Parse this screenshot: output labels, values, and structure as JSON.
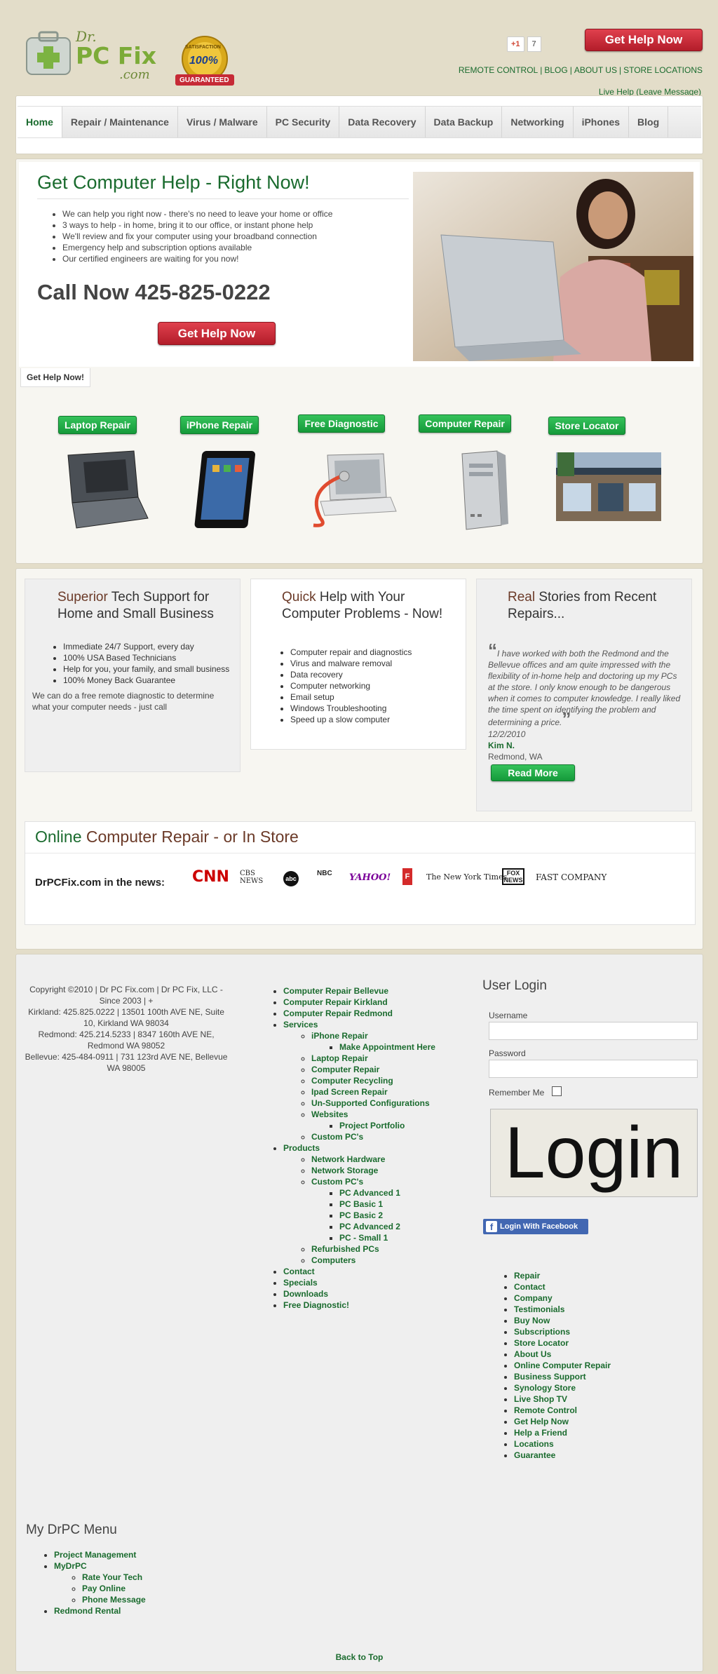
{
  "header": {
    "logo": {
      "dr": "Dr.",
      "name": "PC Fix",
      "com": ".com"
    },
    "seal": {
      "top": "SATISFACTION",
      "pct": "100%",
      "bottom": "GUARANTEED"
    },
    "gplus": {
      "label": "+1",
      "count": "7"
    },
    "help_button": "Get Help Now",
    "top_links": [
      "REMOTE CONTROL",
      "BLOG",
      "ABOUT US",
      "STORE LOCATIONS"
    ],
    "live_help": "Live Help (Leave Message)"
  },
  "nav": [
    "Home",
    "Repair / Maintenance",
    "Virus / Malware",
    "PC Security",
    "Data Recovery",
    "Data Backup",
    "Networking",
    "iPhones",
    "Blog"
  ],
  "hero": {
    "title": "Get Computer Help - Right Now!",
    "bullets": [
      "We can help you right now - there's no need to leave your home or office",
      "3 ways to help - in home, bring it to our office, or instant phone help",
      "We'll review and fix your computer using your broadband connection",
      "Emergency help and subscription options available",
      "Our certified engineers are waiting for you now!"
    ],
    "call": "Call Now 425-825-0222",
    "button": "Get Help Now",
    "tab": "Get Help Now!"
  },
  "services": [
    "Laptop Repair",
    "iPhone Repair",
    "Free Diagnostic",
    "Computer Repair",
    "Store Locator"
  ],
  "columns": {
    "col1": {
      "title_accent": "Superior",
      "title_rest": " Tech Support for Home and Small Business",
      "bullets": [
        "Immediate 24/7 Support, every day",
        "100% USA Based Technicians",
        "Help for you, your family, and small business",
        "100% Money Back Guarantee"
      ],
      "text": "We can do a free remote diagnostic to determine what your computer needs - just call"
    },
    "col2": {
      "title_accent": "Quick",
      "title_rest": " Help with Your Computer Problems - Now!",
      "bullets": [
        "Computer repair and diagnostics",
        "Virus and malware removal",
        "Data recovery",
        "Computer networking",
        "Email setup",
        "Windows Troubleshooting",
        "Speed up a slow computer"
      ]
    },
    "col3": {
      "title_accent": "Real",
      "title_rest": " Stories from Recent Repairs...",
      "quote": "I have worked with both the Redmond and the Bellevue offices and am quite impressed with the flexibility of in-home help and doctoring up my PCs at the store.  I only know enough to be dangerous when it comes to computer knowledge.  I really liked the time spent on identifying the problem and determining a price.",
      "date": "12/2/2010",
      "name": "Kim N.",
      "location": "Redmond, WA",
      "button": "Read More"
    }
  },
  "online": {
    "title_a": "Online",
    "title_b": " Computer Repair - or In Store",
    "in_news": "DrPCFix.com in the news:",
    "media": [
      "CNN",
      "CBS NEWS",
      "abc",
      "NBC",
      "YAHOO!",
      "F",
      "The New York Times",
      "FOX NEWS",
      "FAST COMPANY"
    ]
  },
  "footer": {
    "copyright": "Copyright ©2010 | Dr PC Fix.com | Dr PC Fix, LLC - Since 2003 | +",
    "addr1": "Kirkland: 425.825.0222 |  13501 100th AVE  NE, Suite 10, Kirkland  WA 98034",
    "addr2": "Redmond: 425.214.5233 | 8347 160th AVE NE, Redmond WA 98052",
    "addr3": "Bellevue: 425-484-0911 | 731 123rd AVE NE, Bellevue WA 98005",
    "links": {
      "repair_bellevue": "Computer Repair Bellevue",
      "repair_kirkland": "Computer Repair Kirkland",
      "repair_redmond": "Computer Repair Redmond",
      "services": "Services",
      "iphone_repair": "iPhone Repair",
      "make_appointment": "Make Appointment Here",
      "laptop_repair": "Laptop Repair",
      "computer_repair": "Computer Repair",
      "computer_recycling": "Computer Recycling",
      "ipad_screen": "Ipad Screen Repair",
      "unsupported": "Un-Supported Configurations",
      "websites": "Websites",
      "project_portfolio": "Project Portfolio",
      "custom_pcs": "Custom PC's",
      "products": "Products",
      "network_hardware": "Network Hardware",
      "network_storage": "Network Storage",
      "custom_pcs2": "Custom PC's",
      "pc_adv1": "PC Advanced 1",
      "pc_basic1": "PC Basic 1",
      "pc_basic2": "PC Basic 2",
      "pc_adv2": "PC Advanced 2",
      "pc_small1": "PC - Small 1",
      "refurbished": "Refurbished PCs",
      "computers": "Computers",
      "contact": "Contact",
      "specials": "Specials",
      "downloads": "Downloads",
      "free_diag": "Free Diagnostic!"
    },
    "login": {
      "title": "User Login",
      "username": "Username",
      "password": "Password",
      "remember": "Remember Me",
      "button": "Login",
      "facebook": "Login With Facebook"
    },
    "right_links": [
      "Repair",
      "Contact",
      "Company",
      "Testimonials",
      "Buy Now",
      "Subscriptions",
      "Store Locator",
      "About Us",
      "Online Computer Repair",
      "Business Support",
      "Synology Store",
      "Live Shop TV",
      "Remote Control",
      "Get Help Now",
      "Help a Friend",
      "Locations",
      "Guarantee"
    ],
    "menu": {
      "title": "My DrPC Menu",
      "project": "Project Management",
      "mydrpc": "MyDrPC",
      "rate": "Rate Your Tech",
      "pay": "Pay Online",
      "phone": "Phone Message",
      "redmond": "Redmond Rental"
    },
    "back_to_top": "Back to Top"
  },
  "colors": {
    "brand_green": "#1a6b2e",
    "accent_red": "#c62a36",
    "button_green": "#159a3a",
    "accent_brown": "#6b3a28"
  }
}
